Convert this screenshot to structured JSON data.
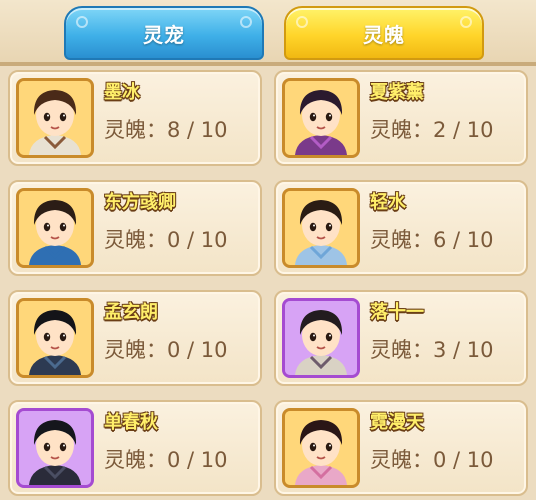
{
  "tabs": [
    {
      "label": "灵宠",
      "color": "#3fb0e8"
    },
    {
      "label": "灵魄",
      "color": "#ffd52a"
    }
  ],
  "count_prefix": "灵魄：",
  "cards": [
    {
      "name": "墨冰",
      "count": "8 / 10",
      "frame": "gold",
      "hair": "#4a2a18",
      "outfit": "#e8e1d2",
      "accent": "#8a5a3a"
    },
    {
      "name": "夏紫薰",
      "count": "2 / 10",
      "frame": "gold",
      "hair": "#2b1a2e",
      "outfit": "#7a3a8a",
      "accent": "#b35cc6"
    },
    {
      "name": "东方彧卿",
      "count": "0 / 10",
      "frame": "gold",
      "hair": "#2b1d16",
      "outfit": "#2f6fb3",
      "accent": "#2f6fb3"
    },
    {
      "name": "轻水",
      "count": "6 / 10",
      "frame": "gold",
      "hair": "#2a1c14",
      "outfit": "#9ec4e6",
      "accent": "#6fa6d8"
    },
    {
      "name": "孟玄朗",
      "count": "0 / 10",
      "frame": "gold",
      "hair": "#141418",
      "outfit": "#2d3a52",
      "accent": "#4b6a8f"
    },
    {
      "name": "落十一",
      "count": "3 / 10",
      "frame": "purple",
      "hair": "#231c1f",
      "outfit": "#d9d2c4",
      "accent": "#6e5c6c"
    },
    {
      "name": "单春秋",
      "count": "0 / 10",
      "frame": "purple",
      "hair": "#15161c",
      "outfit": "#2a2b3a",
      "accent": "#4a4e63"
    },
    {
      "name": "霓漫天",
      "count": "0 / 10",
      "frame": "gold",
      "hair": "#2a1616",
      "outfit": "#e9a8c8",
      "accent": "#d46fa0"
    }
  ]
}
